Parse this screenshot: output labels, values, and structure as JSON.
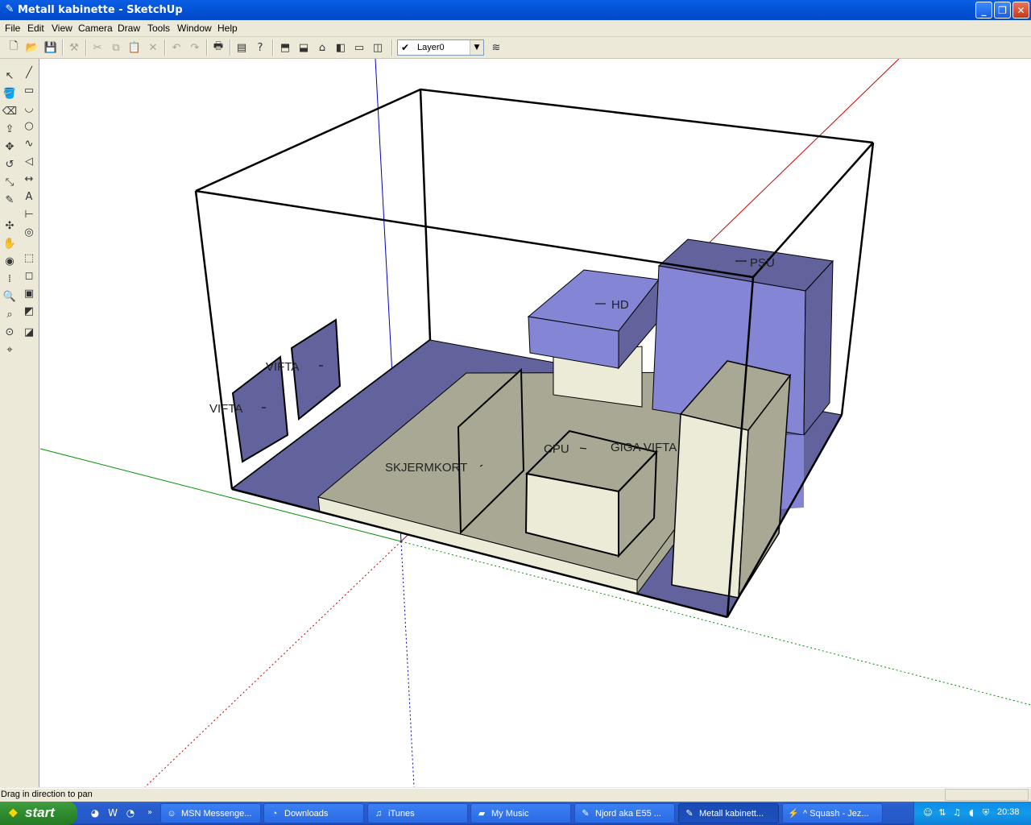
{
  "window": {
    "title": "Metall kabinette - SketchUp",
    "app_icon": "sketchup-icon"
  },
  "menu": [
    "File",
    "Edit",
    "View",
    "Camera",
    "Draw",
    "Tools",
    "Window",
    "Help"
  ],
  "toolbar": {
    "layer_name": "Layer0"
  },
  "model_labels": {
    "psu": "PSU",
    "hd": "HD",
    "vifta1": "VIFTA",
    "vifta2": "VIFTA",
    "cpu": "CPU",
    "giga_vifta": "GIGA VIFTA",
    "skjermkort": "SKJERMKORT"
  },
  "colors": {
    "face_blue": "#8585D5",
    "face_blue_dark": "#62629C",
    "face_beige": "#ECEBD8",
    "face_gray": "#A9A894",
    "axis_red": "#C80000",
    "axis_green": "#009000",
    "axis_blue": "#0000C8"
  },
  "statusbar": {
    "text": "Drag in direction to pan"
  },
  "taskbar": {
    "start": "start",
    "tasks": [
      {
        "label": "MSN Messenge...",
        "icon": "msn-icon"
      },
      {
        "label": "Downloads",
        "icon": "firefox-icon"
      },
      {
        "label": "iTunes",
        "icon": "itunes-icon"
      },
      {
        "label": "My Music",
        "icon": "folder-icon"
      },
      {
        "label": "Njord aka E55 ...",
        "icon": "sketchup-icon"
      },
      {
        "label": "Metall kabinett...",
        "icon": "sketchup-icon",
        "active": true
      },
      {
        "label": "^ Squash - Jez...",
        "icon": "winamp-icon"
      }
    ],
    "clock": "20:38"
  }
}
